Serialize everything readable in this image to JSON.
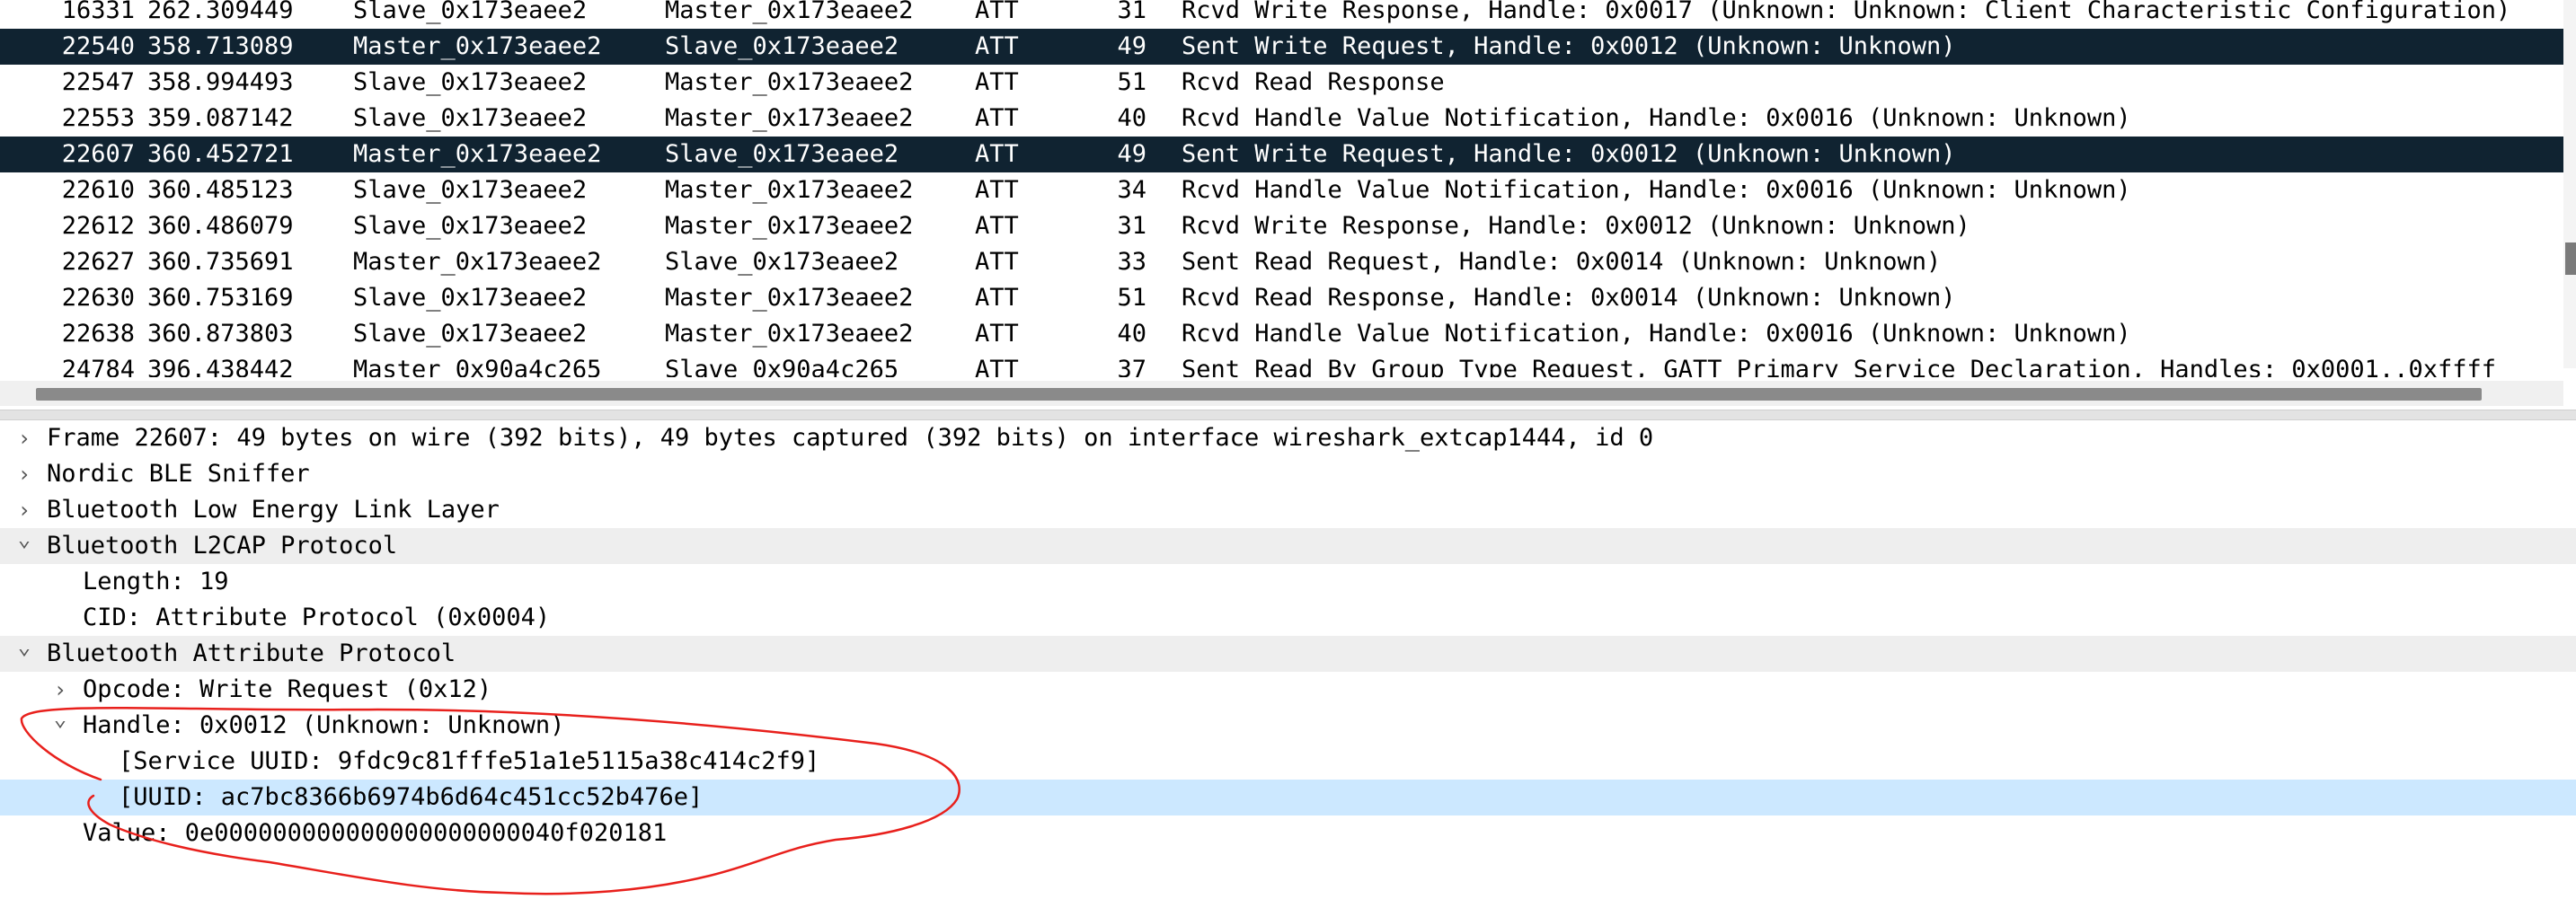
{
  "packet_list": {
    "rows": [
      {
        "no": "16331",
        "time": "262.309449",
        "source": "Slave_0x173eaee2",
        "destination": "Master_0x173eaee2",
        "protocol": "ATT",
        "length": "31",
        "info": "Rcvd Write Response, Handle: 0x0017 (Unknown: Unknown: Client Characteristic Configuration)",
        "selected": false
      },
      {
        "no": "22540",
        "time": "358.713089",
        "source": "Master_0x173eaee2",
        "destination": "Slave_0x173eaee2",
        "protocol": "ATT",
        "length": "49",
        "info": "Sent Write Request, Handle: 0x0012 (Unknown: Unknown)",
        "selected": true
      },
      {
        "no": "22547",
        "time": "358.994493",
        "source": "Slave_0x173eaee2",
        "destination": "Master_0x173eaee2",
        "protocol": "ATT",
        "length": "51",
        "info": "Rcvd Read Response",
        "selected": false
      },
      {
        "no": "22553",
        "time": "359.087142",
        "source": "Slave_0x173eaee2",
        "destination": "Master_0x173eaee2",
        "protocol": "ATT",
        "length": "40",
        "info": "Rcvd Handle Value Notification, Handle: 0x0016 (Unknown: Unknown)",
        "selected": false
      },
      {
        "no": "22607",
        "time": "360.452721",
        "source": "Master_0x173eaee2",
        "destination": "Slave_0x173eaee2",
        "protocol": "ATT",
        "length": "49",
        "info": "Sent Write Request, Handle: 0x0012 (Unknown: Unknown)",
        "selected": true
      },
      {
        "no": "22610",
        "time": "360.485123",
        "source": "Slave_0x173eaee2",
        "destination": "Master_0x173eaee2",
        "protocol": "ATT",
        "length": "34",
        "info": "Rcvd Handle Value Notification, Handle: 0x0016 (Unknown: Unknown)",
        "selected": false
      },
      {
        "no": "22612",
        "time": "360.486079",
        "source": "Slave_0x173eaee2",
        "destination": "Master_0x173eaee2",
        "protocol": "ATT",
        "length": "31",
        "info": "Rcvd Write Response, Handle: 0x0012 (Unknown: Unknown)",
        "selected": false
      },
      {
        "no": "22627",
        "time": "360.735691",
        "source": "Master_0x173eaee2",
        "destination": "Slave_0x173eaee2",
        "protocol": "ATT",
        "length": "33",
        "info": "Sent Read Request, Handle: 0x0014 (Unknown: Unknown)",
        "selected": false
      },
      {
        "no": "22630",
        "time": "360.753169",
        "source": "Slave_0x173eaee2",
        "destination": "Master_0x173eaee2",
        "protocol": "ATT",
        "length": "51",
        "info": "Rcvd Read Response, Handle: 0x0014 (Unknown: Unknown)",
        "selected": false
      },
      {
        "no": "22638",
        "time": "360.873803",
        "source": "Slave_0x173eaee2",
        "destination": "Master_0x173eaee2",
        "protocol": "ATT",
        "length": "40",
        "info": "Rcvd Handle Value Notification, Handle: 0x0016 (Unknown: Unknown)",
        "selected": false
      },
      {
        "no": "24784",
        "time": "396.438442",
        "source": "Master_0x90a4c265",
        "destination": "Slave_0x90a4c265",
        "protocol": "ATT",
        "length": "37",
        "info": "Sent Read By Group Type Request, GATT Primary Service Declaration, Handles: 0x0001..0xffff",
        "selected": false
      }
    ]
  },
  "details": {
    "rows": [
      {
        "expander": "collapsed",
        "text": "Frame 22607: 49 bytes on wire (392 bits), 49 bytes captured (392 bits) on interface wireshark_extcap1444, id 0",
        "state": "normal"
      },
      {
        "expander": "collapsed",
        "text": "Nordic BLE Sniffer",
        "state": "normal"
      },
      {
        "expander": "collapsed",
        "text": "Bluetooth Low Energy Link Layer",
        "state": "normal"
      },
      {
        "expander": "expanded",
        "text": "Bluetooth L2CAP Protocol",
        "state": "shade"
      },
      {
        "expander": "none",
        "text": "Length: 19",
        "state": "normal"
      },
      {
        "expander": "none",
        "text": "CID: Attribute Protocol (0x0004)",
        "state": "normal"
      },
      {
        "expander": "expanded",
        "text": "Bluetooth Attribute Protocol",
        "state": "shade"
      },
      {
        "expander": "collapsed",
        "text": "Opcode: Write Request (0x12)",
        "state": "normal"
      },
      {
        "expander": "expanded",
        "text": "Handle: 0x0012 (Unknown: Unknown)",
        "state": "normal"
      },
      {
        "expander": "none",
        "text": "[Service UUID: 9fdc9c81fffe51a1e5115a38c414c2f9]",
        "state": "normal"
      },
      {
        "expander": "none",
        "text": "[UUID: ac7bc8366b6974b6d64c451cc52b476e]",
        "state": "highlight"
      },
      {
        "expander": "none",
        "text": "Value: 0e000000000000000000000040f020181",
        "state": "normal"
      }
    ]
  },
  "colors": {
    "selected_row_bg": "#102331",
    "selected_row_fg": "#ffffff",
    "highlight_bg": "#cce8ff",
    "section_shade": "#eeeeee",
    "annotation_stroke": "#e8201c"
  },
  "icons": {
    "collapsed": "chevron-right-icon",
    "expanded": "chevron-down-icon"
  }
}
